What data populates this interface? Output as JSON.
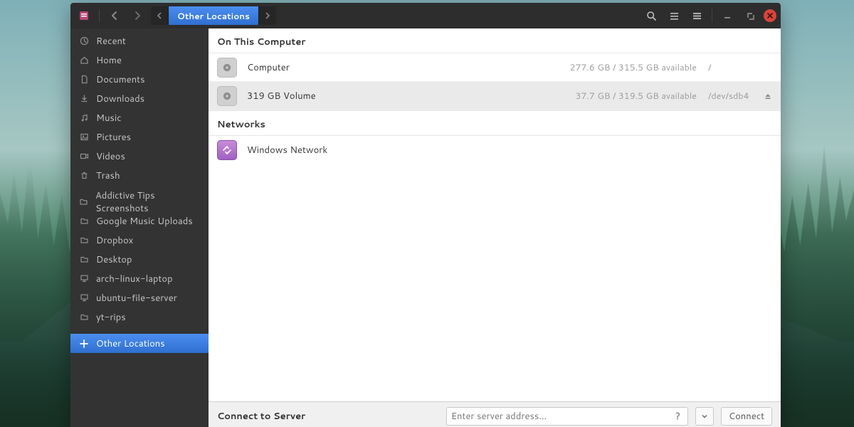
{
  "breadcrumb": {
    "current": "Other Locations"
  },
  "sidebar": {
    "places": [
      {
        "icon": "clock-icon",
        "label": "Recent"
      },
      {
        "icon": "home-icon",
        "label": "Home"
      },
      {
        "icon": "document-icon",
        "label": "Documents"
      },
      {
        "icon": "download-icon",
        "label": "Downloads"
      },
      {
        "icon": "music-icon",
        "label": "Music"
      },
      {
        "icon": "image-icon",
        "label": "Pictures"
      },
      {
        "icon": "video-icon",
        "label": "Videos"
      },
      {
        "icon": "trash-icon",
        "label": "Trash"
      }
    ],
    "bookmarks": [
      {
        "label": "Addictive Tips Screenshots"
      },
      {
        "label": "Google Music Uploads"
      },
      {
        "label": "Dropbox"
      },
      {
        "label": "Desktop"
      },
      {
        "label": "arch-linux-laptop"
      },
      {
        "label": "ubuntu-file-server"
      },
      {
        "label": "yt-rips"
      }
    ],
    "other": {
      "label": "Other Locations"
    }
  },
  "sections": {
    "computer_header": "On This Computer",
    "networks_header": "Networks"
  },
  "volumes": [
    {
      "name": "Computer",
      "meta": "277.6 GB / 315.5 GB available",
      "path": "/",
      "ejectable": false
    },
    {
      "name": "319 GB Volume",
      "meta": "37.7 GB / 319.5 GB available",
      "path": "/dev/sdb4",
      "ejectable": true,
      "selected": true
    }
  ],
  "networks": [
    {
      "name": "Windows Network"
    }
  ],
  "connect": {
    "label": "Connect to Server",
    "placeholder": "Enter server address…",
    "help": "?",
    "button": "Connect"
  }
}
